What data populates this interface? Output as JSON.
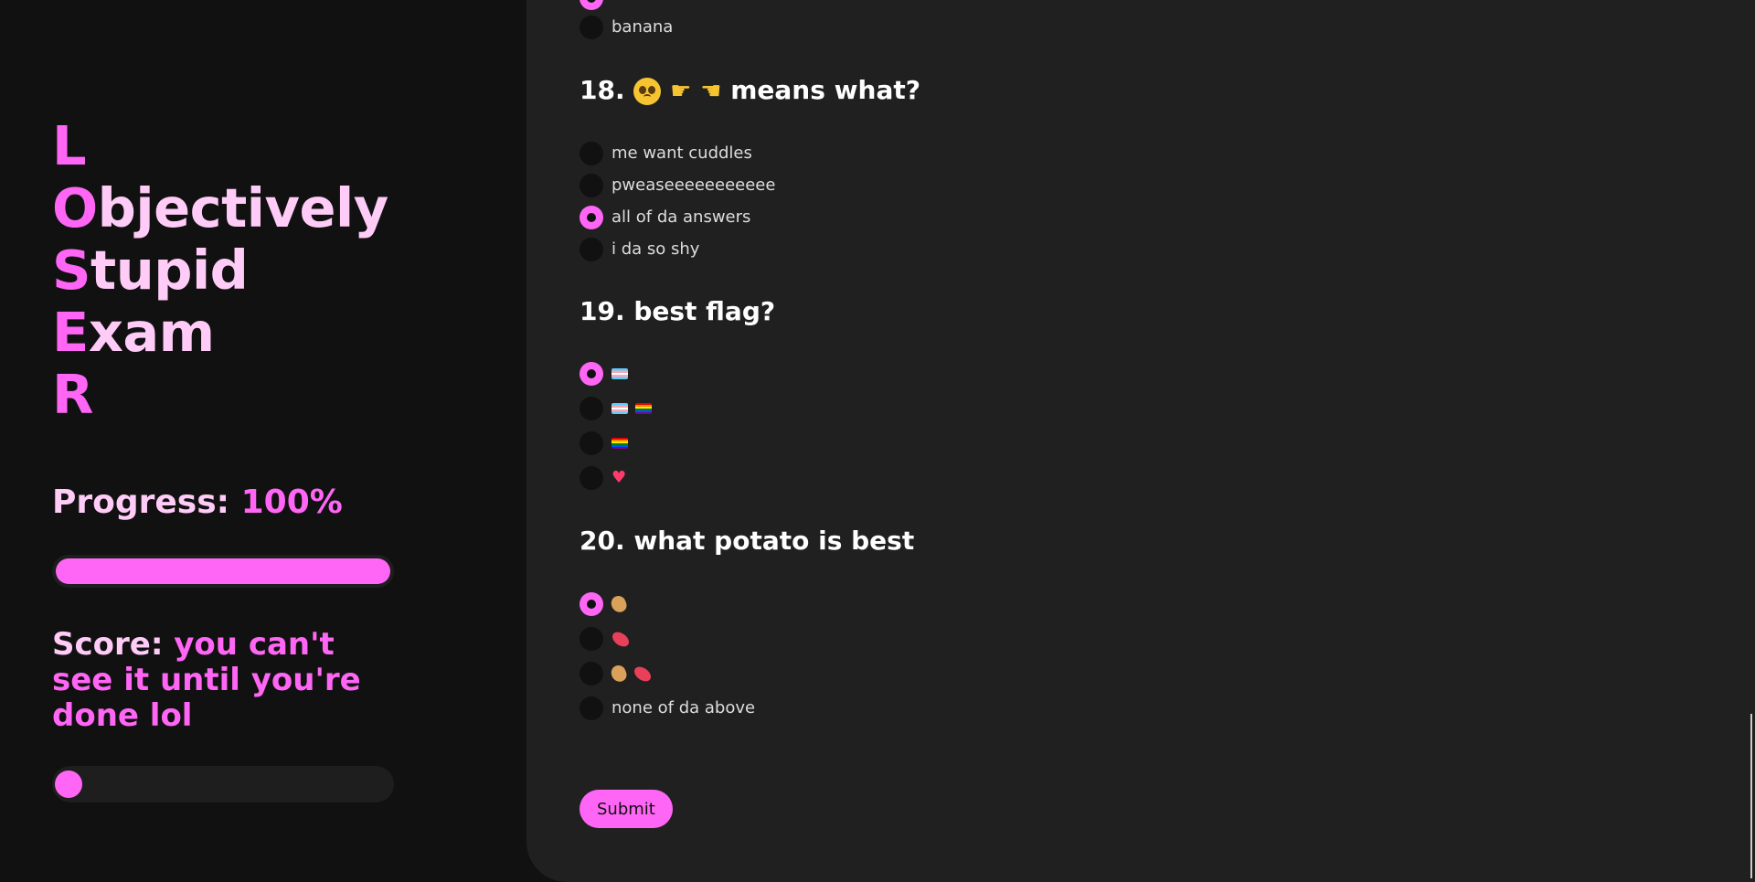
{
  "sidebar": {
    "title_lines": [
      {
        "first": "L",
        "rest": ""
      },
      {
        "first": "O",
        "rest": "bjectively"
      },
      {
        "first": "S",
        "rest": "tupid"
      },
      {
        "first": "E",
        "rest": "xam"
      },
      {
        "first": "R",
        "rest": ""
      }
    ],
    "progress": {
      "label": "Progress: ",
      "value_text": "100%",
      "fraction": 1.0
    },
    "score": {
      "label": "Score: ",
      "value_text": "you can't see it until you're done lol",
      "fraction": 0
    }
  },
  "questions": [
    {
      "title": "",
      "options": [
        {
          "label": "",
          "icon": "",
          "checked": true
        },
        {
          "label": "banana",
          "icon": "",
          "checked": false
        }
      ]
    },
    {
      "title": "18. 🥺 👉 👈 means what?",
      "title_text": " means what?",
      "title_prefix": "18.",
      "title_icons": [
        "pleading-face-icon",
        "pointing-right-icon",
        "pointing-left-icon"
      ],
      "options": [
        {
          "label": "me want cuddles",
          "checked": false
        },
        {
          "label": "pweaseeeeeeeeeee",
          "checked": false
        },
        {
          "label": "all of da answers",
          "checked": true
        },
        {
          "label": "i da so shy",
          "checked": false
        }
      ]
    },
    {
      "title": "19. best flag?",
      "options": [
        {
          "icons": [
            "transgender-flag-icon"
          ],
          "checked": true
        },
        {
          "icons": [
            "transgender-flag-icon",
            "rainbow-flag-icon"
          ],
          "checked": false
        },
        {
          "icons": [
            "rainbow-flag-icon"
          ],
          "checked": false
        },
        {
          "icons": [
            "two-hearts-icon"
          ],
          "checked": false
        }
      ]
    },
    {
      "title": "20. what potato is best",
      "options": [
        {
          "icons": [
            "potato-icon"
          ],
          "checked": true
        },
        {
          "icons": [
            "sweet-potato-icon"
          ],
          "checked": false
        },
        {
          "icons": [
            "potato-icon",
            "sweet-potato-icon"
          ],
          "checked": false
        },
        {
          "label": "none of da above",
          "checked": false
        }
      ]
    }
  ],
  "submit_label": "Submit",
  "colors": {
    "accent": "#ff66f5",
    "accent_light": "#ffccf8",
    "sidebar_bg": "#111111",
    "main_bg": "#202020"
  }
}
